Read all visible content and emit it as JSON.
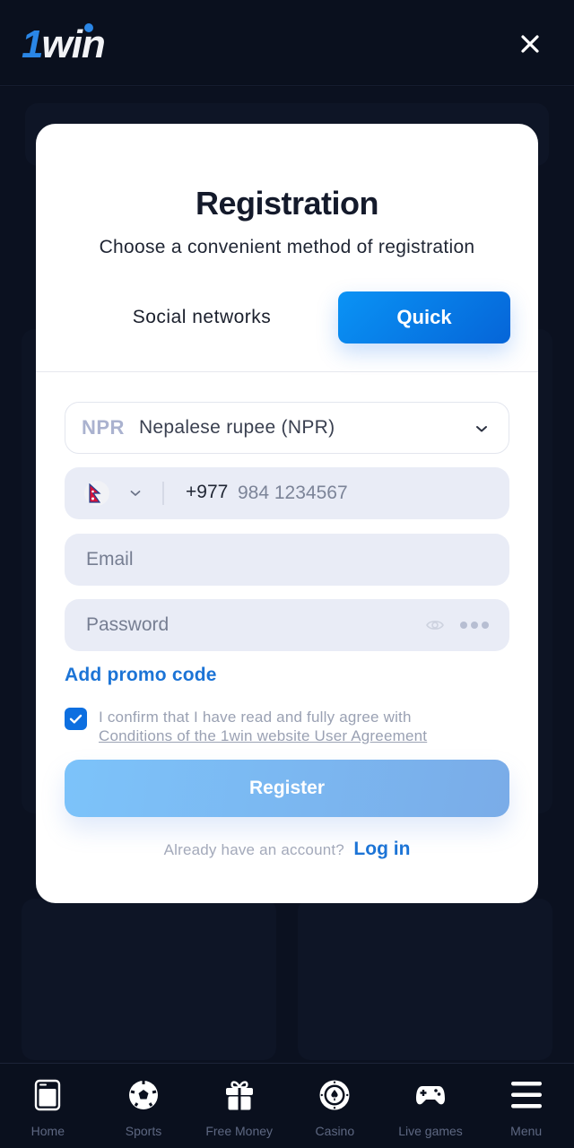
{
  "header": {
    "logo_one": "1",
    "logo_win": "win",
    "close_icon": "close-icon"
  },
  "modal": {
    "title": "Registration",
    "subtitle": "Choose a convenient method of registration",
    "tabs": [
      {
        "label": "Social networks",
        "active": false
      },
      {
        "label": "Quick",
        "active": true
      }
    ],
    "currency": {
      "code": "NPR",
      "name": "Nepalese rupee (NPR)",
      "icon": "chevron-down-icon"
    },
    "phone": {
      "country_flag": "nepal-flag-icon",
      "country_code": "+977",
      "placeholder": "984 1234567",
      "value": ""
    },
    "email": {
      "placeholder": "Email",
      "value": ""
    },
    "password": {
      "placeholder": "Password",
      "value": "",
      "icons": [
        "eye-icon",
        "more-dots-icon"
      ]
    },
    "promo_label": "Add promo code",
    "agreement": {
      "checked": true,
      "text": "I confirm that I have read and fully agree with",
      "link_text": "Conditions of the 1win website User Agreement"
    },
    "register_label": "Register",
    "login_prompt": "Already have an account?",
    "login_link": "Log in"
  },
  "colors": {
    "accent": "#0d6fe0",
    "link": "#1c74d6",
    "background": "#0a0f1c",
    "register_button": "#7cc3fa",
    "input_bg": "#e9ecf6"
  },
  "bottom_nav": [
    {
      "label": "Home",
      "icon": "home-icon"
    },
    {
      "label": "Sports",
      "icon": "soccer-ball-icon"
    },
    {
      "label": "Free Money",
      "icon": "gift-icon"
    },
    {
      "label": "Casino",
      "icon": "casino-chip-icon"
    },
    {
      "label": "Live games",
      "icon": "gamepad-icon"
    },
    {
      "label": "Menu",
      "icon": "menu-icon"
    }
  ]
}
